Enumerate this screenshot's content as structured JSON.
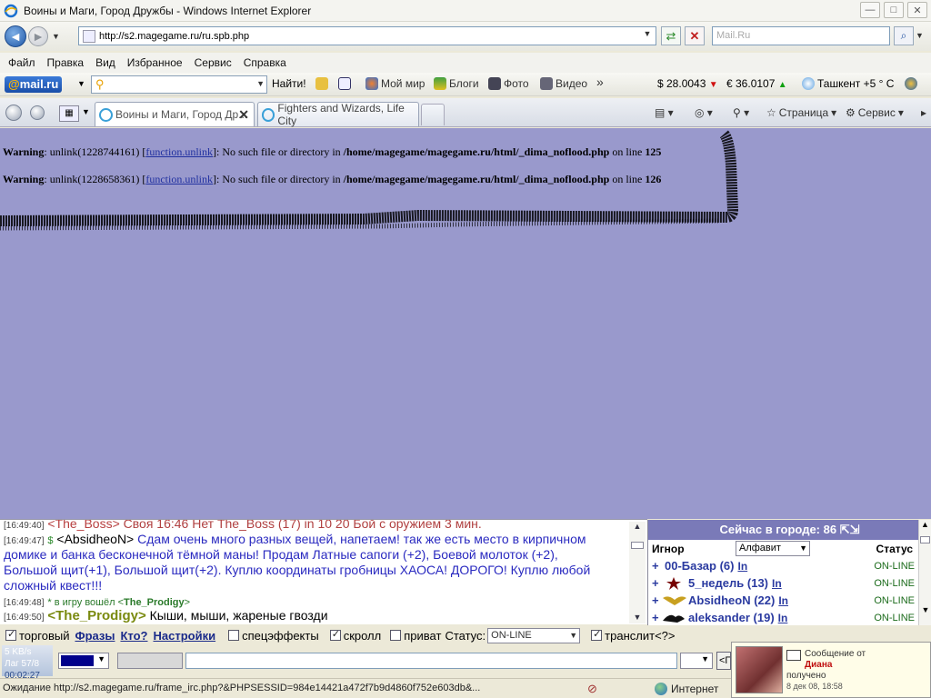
{
  "window": {
    "title": "Воины и Маги, Город Дружбы - Windows Internet Explorer",
    "min": "—",
    "max": "□",
    "close": "✕"
  },
  "address": {
    "url": "http://s2.magegame.ru/ru.spb.php",
    "search_placeholder": "Mail.Ru"
  },
  "menu": [
    "Файл",
    "Правка",
    "Вид",
    "Избранное",
    "Сервис",
    "Справка"
  ],
  "mailbar": {
    "logo_at": "@",
    "logo_text": "mail.ru",
    "find": "Найти!",
    "items": [
      "Мой мир",
      "Блоги",
      "Фото",
      "Видео"
    ],
    "more": "»",
    "usd": "$ 28.0043",
    "eur": "€ 36.0107",
    "weather": "Ташкент +5 ° C"
  },
  "tabs": {
    "active": "Воины и Маги, Город Др...",
    "close": "✕",
    "second": "Fighters and Wizards, Life City",
    "page": "Страница",
    "service": "Сервис"
  },
  "warnings": [
    {
      "label": "Warning",
      "pre": ": unlink(1228744161) [",
      "link": "function.unlink",
      "post": "]: No such file or directory in ",
      "path": "/home/magegame/magegame.ru/html/_dima_noflood.php",
      "online": " on line ",
      "line": "125"
    },
    {
      "label": "Warning",
      "pre": ": unlink(1228658361) [",
      "link": "function.unlink",
      "post": "]: No such file or directory in ",
      "path": "/home/magegame/magegame.ru/html/_dima_noflood.php",
      "online": " on line ",
      "line": "126"
    }
  ],
  "chat": {
    "line0_ts": "[16:49:40]",
    "line0_nick": "<The_Boss>",
    "line0_text": " Своя 16:46 Нет The_Boss (17) in 10 20 Бой с оружием 3 мин.",
    "line1_ts": "[16:49:47]",
    "line1_icon": "$",
    "line1_nick": "<AbsidheoN>",
    "line1_text1": " Сдам очень много разных вещей, напетаем! так же есть место в кирпичном",
    "line1_text2": "домике и банка бесконечной тёмной маны! Продам Латные сапоги (+2), Боевой молоток (+2),",
    "line1_text3": "Большой щит(+1), Большой щит(+2). Куплю координаты гробницы ХАОСА! ДОРОГО! Куплю любой",
    "line1_text4": "сложный квест!!!",
    "line2_ts": "[16:49:48]",
    "line2_sys": "* в игру вошёл <",
    "line2_nick": "The_Prodigy",
    "line2_end": ">",
    "line3_ts": "[16:49:50]",
    "line3_nick": "<The_Prodigy>",
    "line3_text": " Кыши, мыши, жареные гвозди"
  },
  "users": {
    "header_label": "Сейчас в городе: ",
    "count": "86",
    "ignore": "Игнор",
    "sort": "Алфавит",
    "status_col": "Статус",
    "rows": [
      {
        "plus": "+",
        "name": "00-Базар (6)",
        "in": "In",
        "status": "ON-LINE"
      },
      {
        "plus": "+",
        "name": "5_недель (13)",
        "in": "In",
        "status": "ON-LINE"
      },
      {
        "plus": "+",
        "name": "AbsidheoN (22)",
        "in": "In",
        "status": "ON-LINE"
      },
      {
        "plus": "+",
        "name": "aleksander (19)",
        "in": "In",
        "status": "ON-LINE"
      }
    ]
  },
  "options": {
    "trade": "торговый",
    "phrases": "Фразы",
    "who": "Кто?",
    "settings": "Настройки",
    "effects": "спецэффекты",
    "scroll": "скролл",
    "private": "приват",
    "status_label": "Статус:",
    "status_value": "ON-LINE",
    "translit": "транслит",
    "help": "<?>"
  },
  "inputrow": {
    "speed": "5 KB/s",
    "lag": "Лаг 57/8",
    "time": "00:02:27",
    "send": "<П"
  },
  "statusbar": {
    "text": "Ожидание http://s2.magegame.ru/frame_irc.php?&PHPSESSID=984e14421a472f7b9d4860f752e603db&...",
    "zone": "Интернет"
  },
  "notify": {
    "line1": "Сообщение от",
    "from": "Диана",
    "line3": "получено",
    "date": "8 дек 08, 18:58"
  }
}
